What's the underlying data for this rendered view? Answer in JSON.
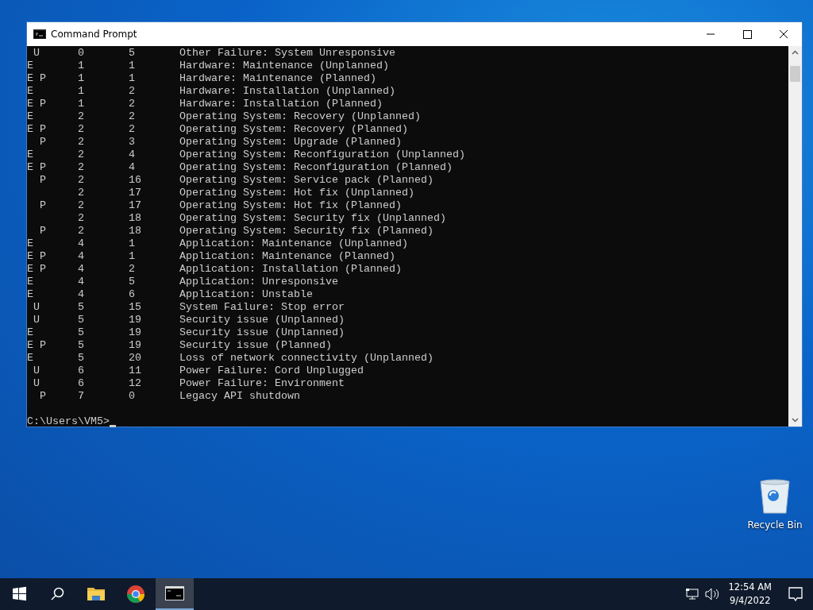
{
  "window": {
    "title": "Command Prompt"
  },
  "console": {
    "rows": [
      {
        "flags": " U",
        "major": "0",
        "minor": "5",
        "reason": "Other Failure: System Unresponsive"
      },
      {
        "flags": "E",
        "major": "1",
        "minor": "1",
        "reason": "Hardware: Maintenance (Unplanned)"
      },
      {
        "flags": "E P",
        "major": "1",
        "minor": "1",
        "reason": "Hardware: Maintenance (Planned)"
      },
      {
        "flags": "E",
        "major": "1",
        "minor": "2",
        "reason": "Hardware: Installation (Unplanned)"
      },
      {
        "flags": "E P",
        "major": "1",
        "minor": "2",
        "reason": "Hardware: Installation (Planned)"
      },
      {
        "flags": "E",
        "major": "2",
        "minor": "2",
        "reason": "Operating System: Recovery (Unplanned)"
      },
      {
        "flags": "E P",
        "major": "2",
        "minor": "2",
        "reason": "Operating System: Recovery (Planned)"
      },
      {
        "flags": "  P",
        "major": "2",
        "minor": "3",
        "reason": "Operating System: Upgrade (Planned)"
      },
      {
        "flags": "E",
        "major": "2",
        "minor": "4",
        "reason": "Operating System: Reconfiguration (Unplanned)"
      },
      {
        "flags": "E P",
        "major": "2",
        "minor": "4",
        "reason": "Operating System: Reconfiguration (Planned)"
      },
      {
        "flags": "  P",
        "major": "2",
        "minor": "16",
        "reason": "Operating System: Service pack (Planned)"
      },
      {
        "major": "2",
        "minor": "17",
        "reason": "Operating System: Hot fix (Unplanned)"
      },
      {
        "flags": "  P",
        "major": "2",
        "minor": "17",
        "reason": "Operating System: Hot fix (Planned)"
      },
      {
        "major": "2",
        "minor": "18",
        "reason": "Operating System: Security fix (Unplanned)"
      },
      {
        "flags": "  P",
        "major": "2",
        "minor": "18",
        "reason": "Operating System: Security fix (Planned)"
      },
      {
        "flags": "E",
        "major": "4",
        "minor": "1",
        "reason": "Application: Maintenance (Unplanned)"
      },
      {
        "flags": "E P",
        "major": "4",
        "minor": "1",
        "reason": "Application: Maintenance (Planned)"
      },
      {
        "flags": "E P",
        "major": "4",
        "minor": "2",
        "reason": "Application: Installation (Planned)"
      },
      {
        "flags": "E",
        "major": "4",
        "minor": "5",
        "reason": "Application: Unresponsive"
      },
      {
        "flags": "E",
        "major": "4",
        "minor": "6",
        "reason": "Application: Unstable"
      },
      {
        "flags": " U",
        "major": "5",
        "minor": "15",
        "reason": "System Failure: Stop error"
      },
      {
        "flags": " U",
        "major": "5",
        "minor": "19",
        "reason": "Security issue (Unplanned)"
      },
      {
        "flags": "E",
        "major": "5",
        "minor": "19",
        "reason": "Security issue (Unplanned)"
      },
      {
        "flags": "E P",
        "major": "5",
        "minor": "19",
        "reason": "Security issue (Planned)"
      },
      {
        "flags": "E",
        "major": "5",
        "minor": "20",
        "reason": "Loss of network connectivity (Unplanned)"
      },
      {
        "flags": " U",
        "major": "6",
        "minor": "11",
        "reason": "Power Failure: Cord Unplugged"
      },
      {
        "flags": " U",
        "major": "6",
        "minor": "12",
        "reason": "Power Failure: Environment"
      },
      {
        "flags": "  P",
        "major": "7",
        "minor": "0",
        "reason": "Legacy API shutdown"
      }
    ],
    "prompt": "C:\\Users\\VM5>"
  },
  "desktop": {
    "icons": [
      {
        "label": "Recycle Bin"
      }
    ]
  },
  "taskbar": {
    "time": "12:54 AM",
    "date": "9/4/2022"
  }
}
